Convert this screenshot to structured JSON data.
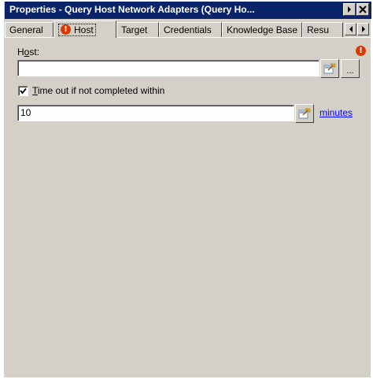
{
  "window": {
    "title": "Properties - Query Host Network Adapters (Query Ho..."
  },
  "tabs": [
    {
      "label": "General"
    },
    {
      "label": "Host",
      "active": true,
      "icon": "error-icon"
    },
    {
      "label": "Target"
    },
    {
      "label": "Credentials"
    },
    {
      "label": "Knowledge Base"
    },
    {
      "label": "Resu"
    }
  ],
  "host": {
    "label_prefix": "H",
    "label_underlined": "o",
    "label_suffix": "st:",
    "value": "",
    "browse_icon": "browse-icon",
    "more_label": "...",
    "error_icon": "error-icon"
  },
  "timeout": {
    "checked": true,
    "label_underlined": "T",
    "label_suffix": "ime out if not completed within",
    "value": "10",
    "units_link": "minutes"
  },
  "colors": {
    "titlebar": "#0a246a",
    "face": "#d4d0c8",
    "error": "#d83b01",
    "link": "#0000ff"
  }
}
